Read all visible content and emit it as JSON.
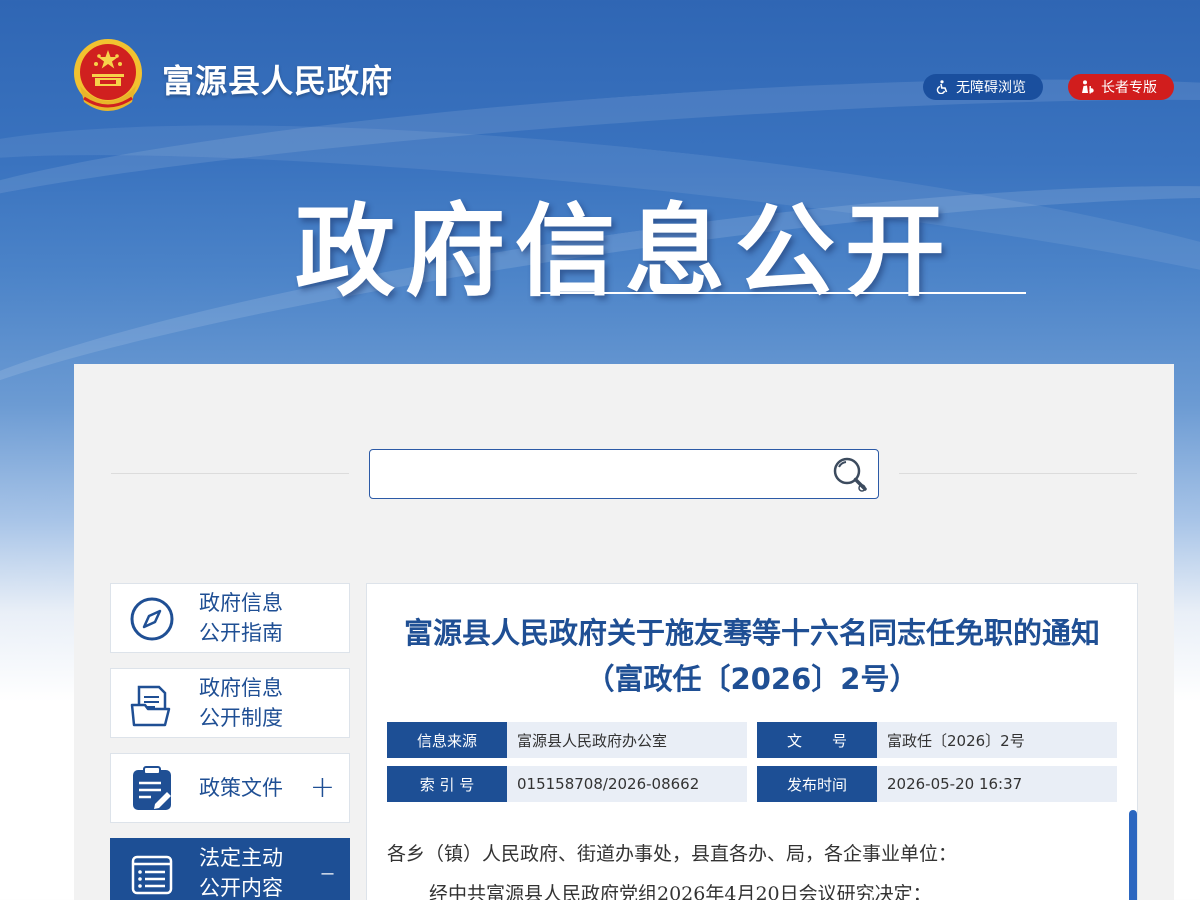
{
  "header": {
    "site_name": "富源县人民政府",
    "accessible_label": "无障碍浏览",
    "elder_label": "长者专版",
    "banner_title": "政府信息公开"
  },
  "search": {
    "placeholder": "",
    "value": ""
  },
  "sidebar": {
    "items": [
      {
        "label": "政府信息\n公开指南",
        "icon": "compass-icon",
        "toggle": ""
      },
      {
        "label": "政府信息\n公开制度",
        "icon": "document-stack-icon",
        "toggle": ""
      },
      {
        "label": "政策文件",
        "icon": "clipboard-edit-icon",
        "toggle": "+"
      },
      {
        "label": "法定主动\n公开内容",
        "icon": "list-icon",
        "toggle": "–"
      }
    ]
  },
  "article": {
    "title": "富源县人民政府关于施友骞等十六名同志任免职的通知（富政任〔2026〕2号）",
    "meta": {
      "source_key": "信息来源",
      "source_val": "富源县人民政府办公室",
      "docno_key": "文　　号",
      "docno_val": "富政任〔2026〕2号",
      "index_key": "索 引 号",
      "index_val": "015158708/2026-08662",
      "time_key": "发布时间",
      "time_val": "2026-05-20 16:37"
    },
    "body": [
      "各乡（镇）人民政府、街道办事处，县直各办、局，各企事业单位：",
      "经中共富源县人民政府党组2026年4月20日会议研究决定："
    ]
  },
  "colors": {
    "brand_blue": "#1d4f95",
    "accent_red": "#d11d1d",
    "title_blue": "#1f4f94"
  }
}
